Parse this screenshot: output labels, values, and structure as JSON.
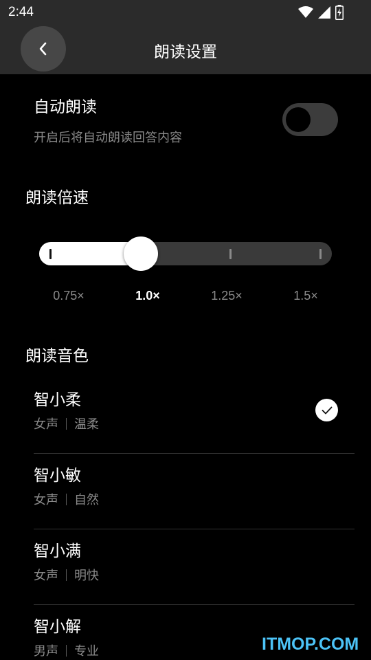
{
  "status_bar": {
    "time": "2:44",
    "icons": [
      "wifi-icon",
      "signal-icon",
      "battery-charging-icon"
    ]
  },
  "app_bar": {
    "back_icon": "chevron-left-icon",
    "title": "朗读设置"
  },
  "auto_read": {
    "title": "自动朗读",
    "description": "开启后将自动朗读回答内容",
    "enabled": false
  },
  "speed": {
    "title": "朗读倍速",
    "options": [
      "0.75×",
      "1.0×",
      "1.25×",
      "1.5×"
    ],
    "selected_index": 1
  },
  "voice": {
    "title": "朗读音色",
    "items": [
      {
        "name": "智小柔",
        "gender": "女声",
        "style": "温柔",
        "selected": true
      },
      {
        "name": "智小敏",
        "gender": "女声",
        "style": "自然",
        "selected": false
      },
      {
        "name": "智小满",
        "gender": "女声",
        "style": "明快",
        "selected": false
      },
      {
        "name": "智小解",
        "gender": "男声",
        "style": "专业",
        "selected": false
      }
    ]
  },
  "watermark": "ITMOP.COM",
  "colors": {
    "background": "#000000",
    "bar": "#2b2b2b",
    "secondary_text": "#8a8a8a",
    "watermark": "#4cc3f7"
  }
}
